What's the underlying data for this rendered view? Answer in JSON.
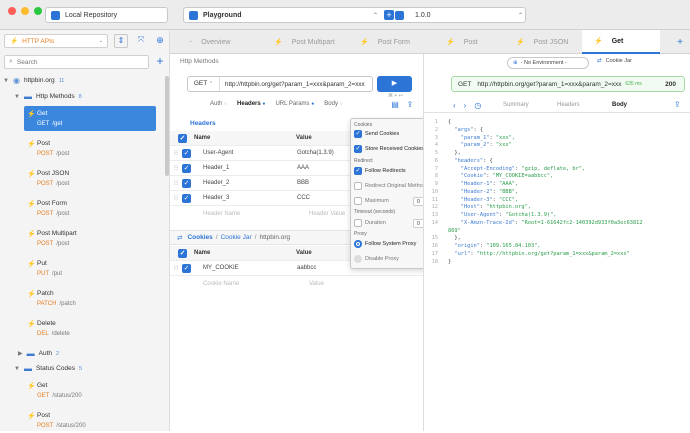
{
  "window": {
    "repository": "Local Repository",
    "project": "Playground",
    "version": "1.0.0"
  },
  "sidebar": {
    "collection": "HTTP APIs",
    "search_placeholder": "Search",
    "domain": "httpbin.org",
    "domain_count": "11",
    "http_methods": "Http Methods",
    "http_methods_count": "8",
    "requests": [
      {
        "name": "Get",
        "method": "GET",
        "path": "/get"
      },
      {
        "name": "Post",
        "method": "POST",
        "path": "/post"
      },
      {
        "name": "Post JSON",
        "method": "POST",
        "path": "/post"
      },
      {
        "name": "Post Form",
        "method": "POST",
        "path": "/post"
      },
      {
        "name": "Post Multipart",
        "method": "POST",
        "path": "/post"
      },
      {
        "name": "Put",
        "method": "PUT",
        "path": "/put"
      },
      {
        "name": "Patch",
        "method": "PATCH",
        "path": "/patch"
      },
      {
        "name": "Delete",
        "method": "DEL",
        "path": "/delete"
      }
    ],
    "auth": "Auth",
    "auth_count": "2",
    "status_codes": "Status Codes",
    "status_codes_count": "5",
    "status_requests": [
      {
        "name": "Get",
        "method": "GET",
        "path": "/status/200"
      },
      {
        "name": "Post",
        "method": "POST",
        "path": "/status/200"
      }
    ]
  },
  "tabs": [
    {
      "label": "Overview",
      "active": false
    },
    {
      "label": "Post Multipart",
      "active": false
    },
    {
      "label": "Post Form",
      "active": false
    },
    {
      "label": "Post",
      "active": false
    },
    {
      "label": "Post JSON",
      "active": false
    },
    {
      "label": "Get",
      "active": true
    }
  ],
  "request": {
    "breadcrumb": "Http Methods",
    "method": "GET",
    "url": "http://httpbin.org/get?param_1=xxx&param_2=xxx",
    "subtabs": [
      "Auth",
      "Headers",
      "URL Params",
      "Body"
    ],
    "shortcut": "⌘ + ↩",
    "headers_title": "Headers",
    "headers_col_name": "Name",
    "headers_col_value": "Value",
    "headers": [
      {
        "name": "User-Agent",
        "value": "Gotcha(1.3.9)"
      },
      {
        "name": "Header_1",
        "value": "AAA"
      },
      {
        "name": "Header_2",
        "value": "BBB"
      },
      {
        "name": "Header_3",
        "value": "CCC"
      }
    ],
    "header_name_placeholder": "Header Name",
    "header_value_placeholder": "Header Value",
    "cookies_title": "Cookies",
    "cookies_path_jar": "Cookie Jar",
    "cookies_path_domain": "httpbin.org",
    "cookies": [
      {
        "name": "MY_COOKIE",
        "value": "aabbcc"
      }
    ],
    "cookie_name_placeholder": "Cookie Name",
    "cookie_value_placeholder": "Value"
  },
  "popup": {
    "cookies_section": "Cookies",
    "send_cookies": "Send Cookies",
    "store_cookies": "Store Received Cookies",
    "redirect_section": "Redirect",
    "follow_redirects": "Follow Redirects",
    "redirect_original": "Redirect Original Method",
    "maximum": "Maximum",
    "maximum_value": "0",
    "timeout_section": "Timeout (seconds)",
    "duration": "Duration",
    "duration_value": "0",
    "proxy_section": "Proxy",
    "follow_system_proxy": "Follow System Proxy",
    "disable_proxy": "Disable Proxy"
  },
  "response": {
    "environment": "- No Environment -",
    "cookie_jar": "Cookie Jar",
    "method": "GET",
    "url": "http://httpbin.org/get?param_1=xxx&param_2=xxx",
    "time": "635 ms",
    "status": "200",
    "subtabs": [
      "Summary",
      "Headers",
      "Body"
    ],
    "lines": [
      {
        "n": "1",
        "t": "{"
      },
      {
        "n": "2",
        "t": "  \"args\": {"
      },
      {
        "n": "3",
        "t": "    \"param_1\": \"xxx\","
      },
      {
        "n": "4",
        "t": "    \"param_2\": \"xxx\""
      },
      {
        "n": "5",
        "t": "  },"
      },
      {
        "n": "6",
        "t": "  \"headers\": {"
      },
      {
        "n": "7",
        "t": "    \"Accept-Encoding\": \"gzip, deflate, br\","
      },
      {
        "n": "8",
        "t": "    \"Cookie\": \"MY_COOKIE=aabbcc\","
      },
      {
        "n": "9",
        "t": "    \"Header-1\": \"AAA\","
      },
      {
        "n": "10",
        "t": "    \"Header-2\": \"BBB\","
      },
      {
        "n": "11",
        "t": "    \"Header-3\": \"CCC\","
      },
      {
        "n": "12",
        "t": "    \"Host\": \"httpbin.org\","
      },
      {
        "n": "13",
        "t": "    \"User-Agent\": \"Gotcha(1.3.9)\","
      },
      {
        "n": "14",
        "t": "    \"X-Amzn-Trace-Id\": \"Root=1-61642fc2-140392d933f0a3ec63812"
      },
      {
        "n": "",
        "t": "869\""
      },
      {
        "n": "15",
        "t": "  },"
      },
      {
        "n": "16",
        "t": "  \"origin\": \"109.165.84.103\","
      },
      {
        "n": "17",
        "t": "  \"url\": \"http://httpbin.org/get?param_1=xxx&param_2=xxx\""
      },
      {
        "n": "18",
        "t": "}"
      }
    ]
  },
  "colors": {
    "accent": "#2c74d6",
    "method": "#e67e22",
    "selected": "#3b87dd",
    "status_green": "#4caf50"
  }
}
